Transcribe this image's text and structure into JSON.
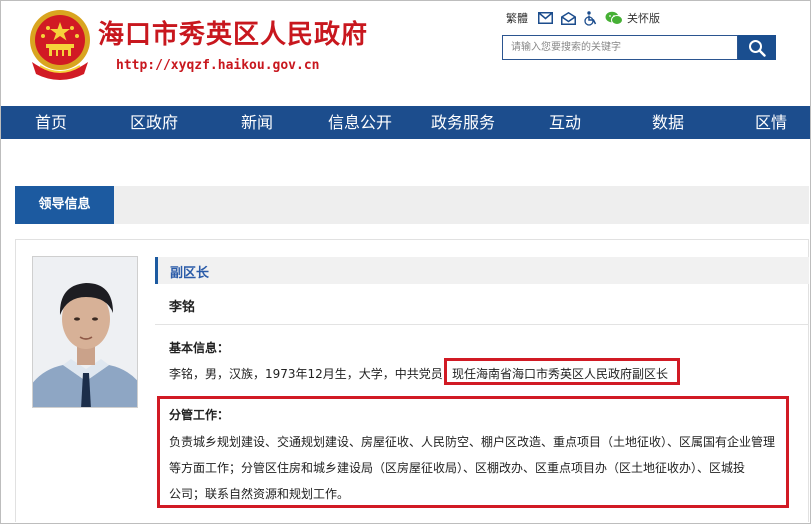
{
  "header": {
    "site_title": "海口市秀英区人民政府",
    "site_url": "http://xyqzf.haikou.gov.cn",
    "emblem_icon": "national-emblem-icon"
  },
  "tools": {
    "traditional_label": "繁體",
    "mail_icon": "mail-icon",
    "open_mail_icon": "open-mail-icon",
    "accessibility_icon": "wheelchair-icon",
    "wechat_icon": "wechat-icon",
    "care_label": "关怀版"
  },
  "search": {
    "placeholder": "请输入您要搜索的关键字",
    "button_icon": "search-icon"
  },
  "nav": {
    "items": [
      "首页",
      "区政府",
      "新闻",
      "信息公开",
      "政务服务",
      "互动",
      "数据",
      "区情"
    ]
  },
  "tab": {
    "active_label": "领导信息"
  },
  "leader": {
    "photo_icon": "portrait-photo",
    "title": "副区长",
    "name": "李铭",
    "basic_heading": "基本信息：",
    "basic_text": "李铭，男，汉族，1973年12月生，大学，中共党员",
    "position": "现任海南省海口市秀英区人民政府副区长",
    "duties_heading": "分管工作：",
    "duties_lines": [
      "负责城乡规划建设、交通规划建设、房屋征收、人民防空、棚户区改造、重点项目（土地征收）、区属国有企业管理",
      "等方面工作；分管区住房和城乡建设局（区房屋征收局）、区棚改办、区重点项目办（区土地征收办）、区城投",
      "公司；联系自然资源和规划工作。"
    ]
  },
  "colors": {
    "brand_red": "#c8171e",
    "nav_blue": "#1c4d8d",
    "tab_blue": "#1c5aa0",
    "highlight_red": "#d11a24"
  }
}
